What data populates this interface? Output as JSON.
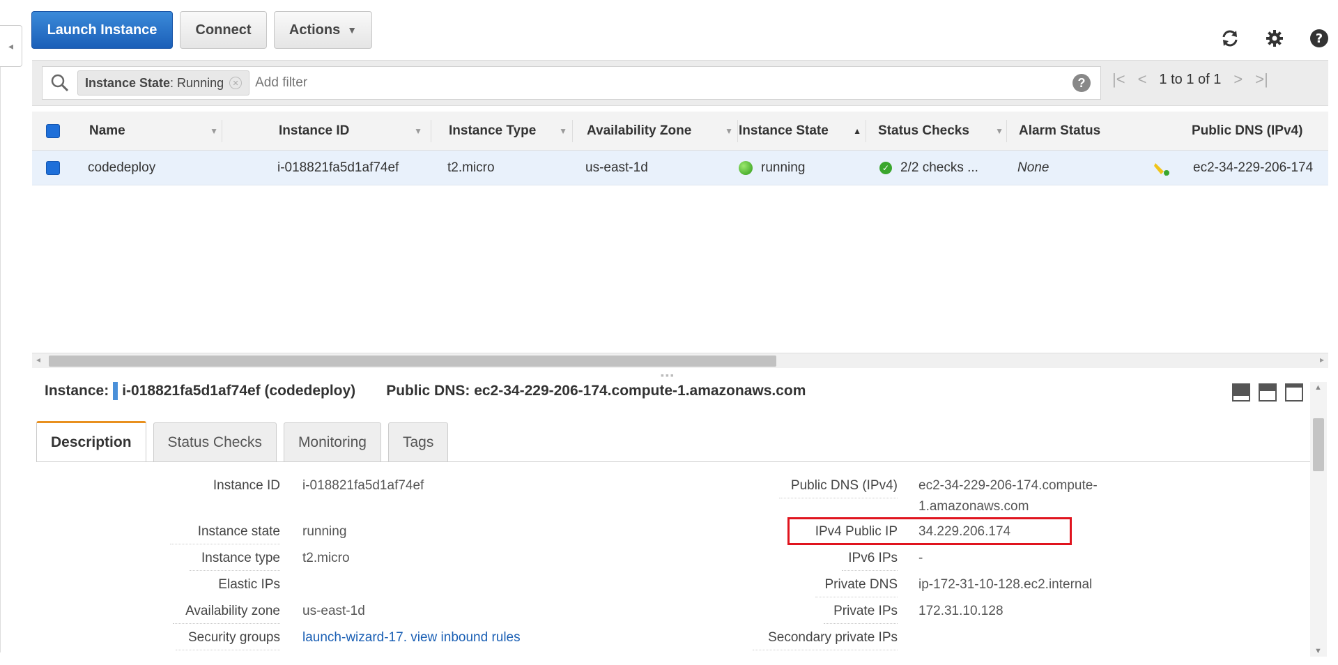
{
  "toolbar": {
    "launch_label": "Launch Instance",
    "connect_label": "Connect",
    "actions_label": "Actions"
  },
  "filter": {
    "chip_key": "Instance State",
    "chip_value": ": Running",
    "placeholder": "Add filter",
    "pager_text": "1 to 1 of 1"
  },
  "table": {
    "columns": [
      "Name",
      "Instance ID",
      "Instance Type",
      "Availability Zone",
      "Instance State",
      "Status Checks",
      "Alarm Status",
      "Public DNS (IPv4)"
    ],
    "row": {
      "name": "codedeploy",
      "instance_id": "i-018821fa5d1af74ef",
      "instance_type": "t2.micro",
      "availability_zone": "us-east-1d",
      "instance_state": "running",
      "status_checks": "2/2 checks ...",
      "alarm_status": "None",
      "public_dns": "ec2-34-229-206-174"
    }
  },
  "detail": {
    "instance_label": "Instance:",
    "instance_value": "i-018821fa5d1af74ef (codedeploy)",
    "dns_label": "Public DNS: ec2-34-229-206-174.compute-1.amazonaws.com"
  },
  "tabs": [
    "Description",
    "Status Checks",
    "Monitoring",
    "Tags"
  ],
  "description": {
    "left": [
      {
        "key": "Instance ID",
        "value": "i-018821fa5d1af74ef"
      },
      {
        "key": "Instance state",
        "value": "running"
      },
      {
        "key": "Instance type",
        "value": "t2.micro"
      },
      {
        "key": "Elastic IPs",
        "value": ""
      },
      {
        "key": "Availability zone",
        "value": "us-east-1d"
      },
      {
        "key": "Security groups",
        "value": "launch-wizard-17",
        "link2": "view inbound rules"
      }
    ],
    "right": [
      {
        "key": "Public DNS (IPv4)",
        "value": "ec2-34-229-206-174.compute-",
        "value2": "1.amazonaws.com"
      },
      {
        "key": "IPv4 Public IP",
        "value": "34.229.206.174"
      },
      {
        "key": "IPv6 IPs",
        "value": "-"
      },
      {
        "key": "Private DNS",
        "value": "ip-172-31-10-128.ec2.internal"
      },
      {
        "key": "Private IPs",
        "value": "172.31.10.128"
      },
      {
        "key": "Secondary private IPs",
        "value": ""
      }
    ]
  },
  "colors": {
    "primary_button": "#1b5fb8",
    "selected_row": "#e9f1fb",
    "active_tab_accent": "#e8901f",
    "highlight_box": "#e0141e",
    "link": "#1a5fb4"
  }
}
